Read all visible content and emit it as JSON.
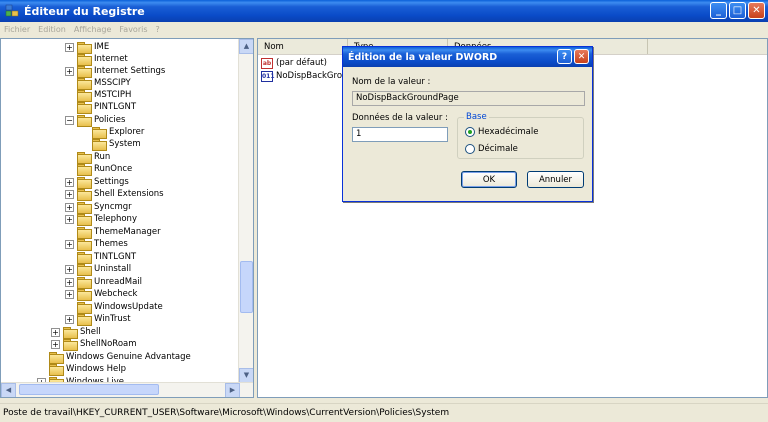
{
  "window": {
    "title": "Éditeur du Registre",
    "icon": "regedit-icon",
    "controls": [
      "minimize",
      "maximize",
      "close"
    ]
  },
  "menu": [
    "Fichier",
    "Edition",
    "Affichage",
    "Favoris",
    "?"
  ],
  "tree": {
    "items": [
      {
        "label": "IME",
        "expander": "+"
      },
      {
        "label": "Internet",
        "expander": ""
      },
      {
        "label": "Internet Settings",
        "expander": "+"
      },
      {
        "label": "MSSCIPY",
        "expander": ""
      },
      {
        "label": "MSTCIPH",
        "expander": ""
      },
      {
        "label": "PINTLGNT",
        "expander": ""
      },
      {
        "label": "Policies",
        "expander": "−"
      },
      {
        "label": "Explorer",
        "expander": ""
      },
      {
        "label": "System",
        "expander": ""
      },
      {
        "label": "Run",
        "expander": ""
      },
      {
        "label": "RunOnce",
        "expander": ""
      },
      {
        "label": "Settings",
        "expander": "+"
      },
      {
        "label": "Shell Extensions",
        "expander": "+"
      },
      {
        "label": "Syncmgr",
        "expander": "+"
      },
      {
        "label": "Telephony",
        "expander": "+"
      },
      {
        "label": "ThemeManager",
        "expander": ""
      },
      {
        "label": "Themes",
        "expander": "+"
      },
      {
        "label": "TINTLGNT",
        "expander": ""
      },
      {
        "label": "Uninstall",
        "expander": "+"
      },
      {
        "label": "UnreadMail",
        "expander": "+"
      },
      {
        "label": "Webcheck",
        "expander": "+"
      },
      {
        "label": "WindowsUpdate",
        "expander": ""
      },
      {
        "label": "WinTrust",
        "expander": "+"
      },
      {
        "label": "Shell",
        "expander": "+"
      },
      {
        "label": "ShellNoRoam",
        "expander": "+"
      },
      {
        "label": "Windows Genuine Advantage",
        "expander": ""
      },
      {
        "label": "Windows Help",
        "expander": ""
      },
      {
        "label": "Windows Live",
        "expander": "+"
      }
    ]
  },
  "list": {
    "columns": [
      "Nom",
      "Type",
      "Données"
    ],
    "rows": [
      {
        "name": "(par défaut)",
        "icon": "ab"
      },
      {
        "name": "NoDispBackGroun",
        "icon": "011"
      }
    ]
  },
  "status": {
    "path": "Poste de travail\\HKEY_CURRENT_USER\\Software\\Microsoft\\Windows\\CurrentVersion\\Policies\\System"
  },
  "dialog": {
    "title": "Édition de la valeur DWORD",
    "help_label": "?",
    "close_label": "✕",
    "value_name_label": "Nom de la valeur :",
    "value_name": "NoDispBackGroundPage",
    "value_data_label": "Données de la valeur :",
    "value_data": "1",
    "base_label": "Base",
    "hex_label": "Hexadécimale",
    "dec_label": "Décimale",
    "selected_base": "hex",
    "ok_label": "OK",
    "cancel_label": "Annuler"
  }
}
